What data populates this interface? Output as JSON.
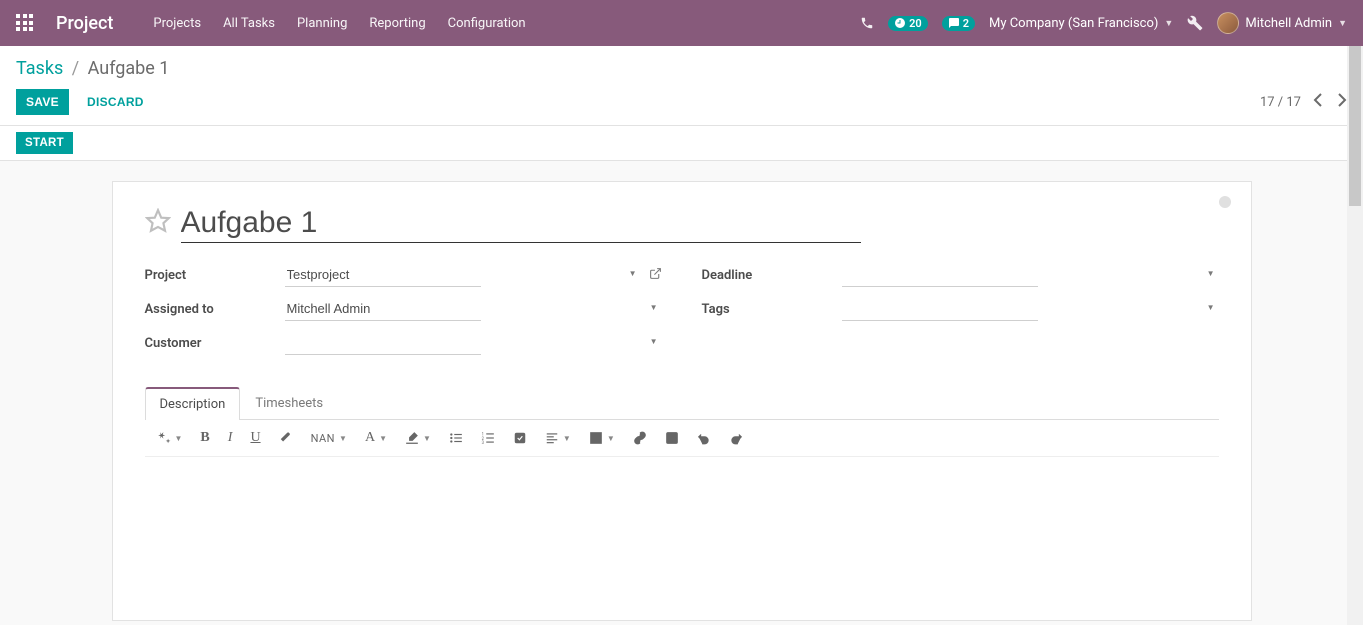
{
  "navbar": {
    "brand": "Project",
    "menu": [
      "Projects",
      "All Tasks",
      "Planning",
      "Reporting",
      "Configuration"
    ],
    "timer_badge": "20",
    "chat_badge": "2",
    "company": "My Company (San Francisco)",
    "user": "Mitchell Admin"
  },
  "breadcrumb": {
    "root": "Tasks",
    "current": "Aufgabe 1"
  },
  "buttons": {
    "save": "SAVE",
    "discard": "DISCARD",
    "start": "START"
  },
  "pager": {
    "text": "17 / 17"
  },
  "form": {
    "title": "Aufgabe 1",
    "fields": {
      "project_label": "Project",
      "project_value": "Testproject",
      "assigned_label": "Assigned to",
      "assigned_value": "Mitchell Admin",
      "customer_label": "Customer",
      "customer_value": "",
      "deadline_label": "Deadline",
      "deadline_value": "",
      "tags_label": "Tags",
      "tags_value": ""
    }
  },
  "tabs": {
    "description": "Description",
    "timesheets": "Timesheets"
  },
  "editor": {
    "font_size_label": "NAN",
    "bold": "B",
    "italic": "I",
    "underline": "U",
    "font_family": "A"
  }
}
